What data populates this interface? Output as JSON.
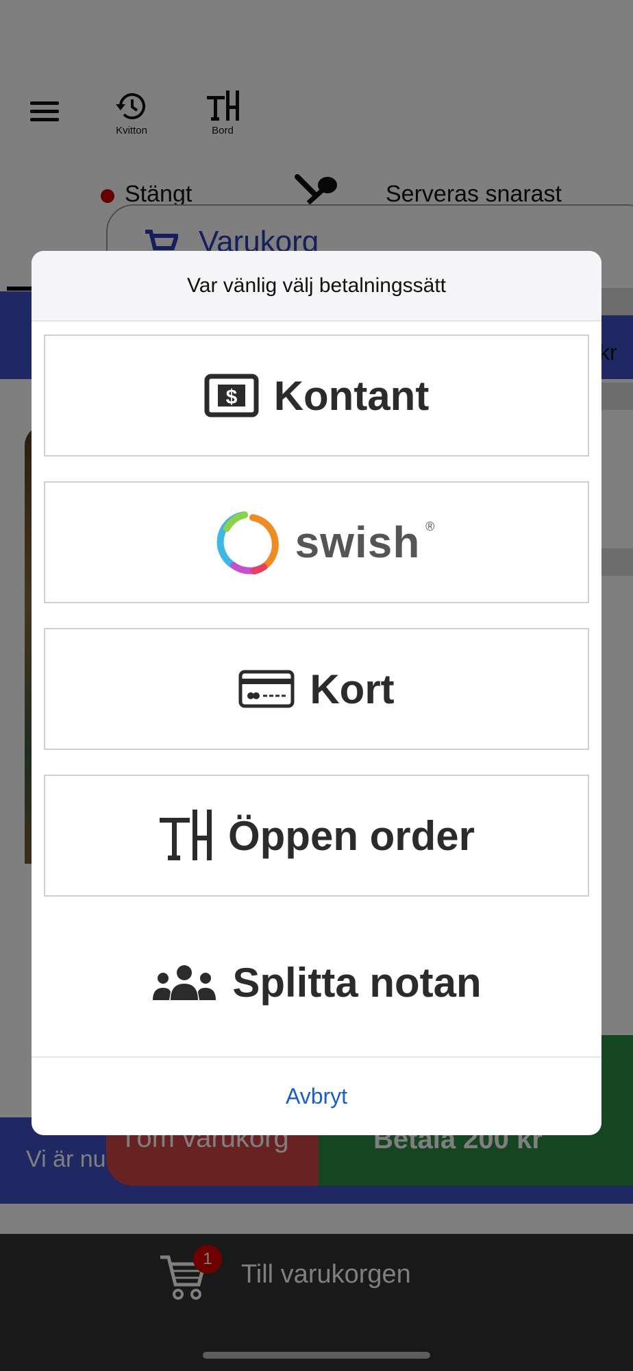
{
  "topbar": {
    "receipts_label": "Kvitton",
    "table_label": "Bord"
  },
  "status": {
    "state": "Stängt",
    "serving": "Serveras snarast"
  },
  "cart": {
    "title": "Varukorg",
    "currency_suffix": "kr",
    "clear_label": "Töm varukorg",
    "pay_label": "Betala 200 kr",
    "notice": "Vi är nu"
  },
  "footer": {
    "badge_count": "1",
    "label": "Till varukorgen"
  },
  "dialog": {
    "title": "Var vänlig välj betalningssätt",
    "options": [
      {
        "label": "Kontant",
        "icon": "cash-icon"
      },
      {
        "label": "swish",
        "icon": "swish-logo-icon"
      },
      {
        "label": "Kort",
        "icon": "credit-card-icon"
      },
      {
        "label": "Öppen order",
        "icon": "table-icon"
      },
      {
        "label": "Splitta notan",
        "icon": "group-icon"
      }
    ],
    "cancel_label": "Avbryt"
  },
  "colors": {
    "brand_blue": "#3e51c6",
    "clear_red": "#d34545",
    "pay_green": "#2c8a45",
    "cancel_blue": "#1a5ccc",
    "status_red": "#cc0000"
  }
}
